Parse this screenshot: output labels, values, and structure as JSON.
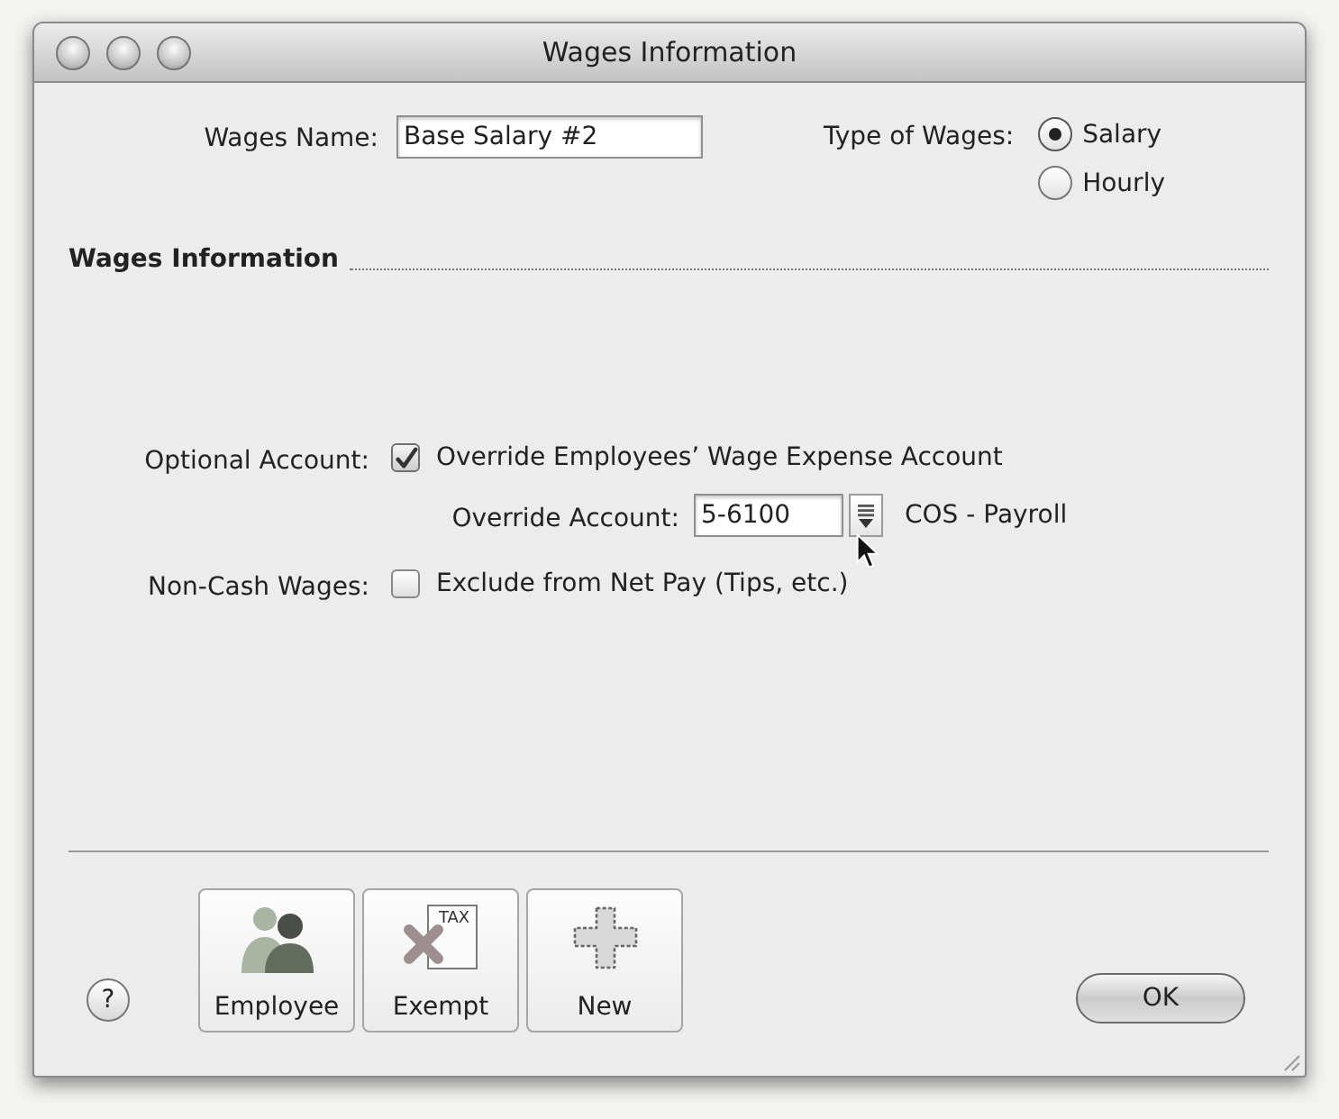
{
  "window": {
    "title": "Wages Information"
  },
  "wages_name": {
    "label": "Wages Name:",
    "value": "Base Salary #2"
  },
  "type_of_wages": {
    "label": "Type of Wages:",
    "options": [
      {
        "label": "Salary",
        "selected": true
      },
      {
        "label": "Hourly",
        "selected": false
      }
    ]
  },
  "section": {
    "title": "Wages Information"
  },
  "optional_account": {
    "label": "Optional Account:",
    "checkbox": {
      "label": "Override Employees’ Wage Expense Account",
      "checked": true
    }
  },
  "override_account": {
    "label": "Override Account:",
    "value": "5-6100",
    "account_name": "COS - Payroll"
  },
  "non_cash_wages": {
    "label": "Non-Cash Wages:",
    "checkbox": {
      "label": "Exclude from Net Pay (Tips, etc.)",
      "checked": false
    }
  },
  "help_button": {
    "label": "?"
  },
  "toolbar_buttons": [
    {
      "kind": "employee",
      "label": "Employee"
    },
    {
      "kind": "exempt",
      "label": "Exempt",
      "icon_text": "TAX"
    },
    {
      "kind": "new",
      "label": "New"
    }
  ],
  "ok_button": {
    "label": "OK"
  }
}
